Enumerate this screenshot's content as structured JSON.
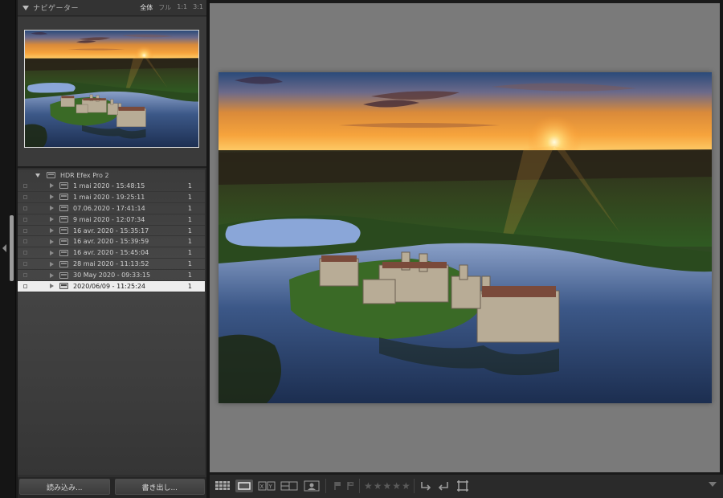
{
  "navigator": {
    "title": "ナビゲーター",
    "zoom": {
      "fit": "全体",
      "fill": "フル",
      "one": "1:1",
      "custom": "3:1"
    }
  },
  "collections": {
    "parent": {
      "label": "HDR Efex Pro 2"
    },
    "items": [
      {
        "label": "1 mai 2020 - 15:48:15",
        "count": "1"
      },
      {
        "label": "1 mai 2020 - 19:25:11",
        "count": "1"
      },
      {
        "label": "07.06.2020 - 17:41:14",
        "count": "1"
      },
      {
        "label": "9 mai 2020 - 12:07:34",
        "count": "1"
      },
      {
        "label": "16 avr. 2020 - 15:35:17",
        "count": "1"
      },
      {
        "label": "16 avr. 2020 - 15:39:59",
        "count": "1"
      },
      {
        "label": "16 avr. 2020 - 15:45:04",
        "count": "1"
      },
      {
        "label": "28 mai 2020 - 11:13:52",
        "count": "1"
      },
      {
        "label": "30 May 2020 - 09:33:15",
        "count": "1"
      },
      {
        "label": "2020/06/09 - 11:25:24",
        "count": "1",
        "selected": true
      }
    ]
  },
  "buttons": {
    "import": "読み込み...",
    "export": "書き出し..."
  },
  "toolbar": {
    "rating_stars": "★★★★★"
  },
  "colors": {
    "panel": "#2f2f2f",
    "main_bg": "#7a7a7a",
    "selected_row": "#ededed"
  }
}
